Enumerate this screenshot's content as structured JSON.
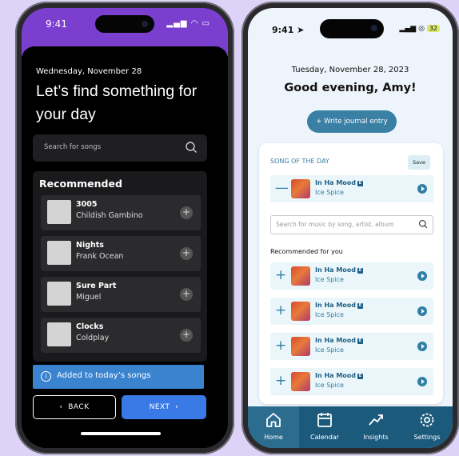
{
  "colors": {
    "accent_purple": "#7b3fd0",
    "accent_blue": "#3a7ae6",
    "teal": "#3a7fa4",
    "tabbar": "#1c5a7c"
  },
  "left": {
    "status_time": "9:41",
    "date": "Wednesday,  November 28",
    "heading": "Let’s find something for your day",
    "search_placeholder": "Search for songs",
    "section_title": "Recommended",
    "songs": [
      {
        "name": "3005",
        "artist": "Childish Gambino"
      },
      {
        "name": "Nights",
        "artist": "Frank Ocean"
      },
      {
        "name": "Sure Part",
        "artist": "Miguel"
      },
      {
        "name": "Clocks",
        "artist": "Coldplay"
      }
    ],
    "toast": "Added to today’s songs",
    "back_label": "BACK",
    "next_label": "NEXT",
    "icons": {
      "search": "search-icon",
      "add": "plus-icon",
      "info": "info-icon",
      "back": "chevron-left-icon",
      "next": "chevron-right-icon"
    }
  },
  "right": {
    "status_time": "9:41",
    "battery": "32",
    "date": "Tuesday, November 28, 2023",
    "greeting": "Good evening, Amy!",
    "write_label": "+ Write journal entry",
    "song_of_day_label": "SONG OF THE DAY",
    "save_label": "Save",
    "song_of_day": {
      "sign": "—",
      "name": "In Ha Mood",
      "artist": "Ice Spice",
      "badge": "E"
    },
    "search_placeholder": "Search for music by song, artist, album",
    "recommended_label": "Recommended for you",
    "recommended": [
      {
        "sign": "+",
        "name": "In Ha Mood",
        "artist": "Ice Spice",
        "badge": "E"
      },
      {
        "sign": "+",
        "name": "In Ha Mood",
        "artist": "Ice Spice",
        "badge": "E"
      },
      {
        "sign": "+",
        "name": "In Ha Mood",
        "artist": "Ice Spice",
        "badge": "E"
      },
      {
        "sign": "+",
        "name": "In Ha Mood",
        "artist": "Ice Spice",
        "badge": "E"
      }
    ],
    "tabs": [
      {
        "label": "Home",
        "icon": "home-icon",
        "active": true
      },
      {
        "label": "Calendar",
        "icon": "calendar-icon",
        "active": false
      },
      {
        "label": "Insights",
        "icon": "trend-icon",
        "active": false
      },
      {
        "label": "Settings",
        "icon": "gear-icon",
        "active": false
      }
    ]
  }
}
